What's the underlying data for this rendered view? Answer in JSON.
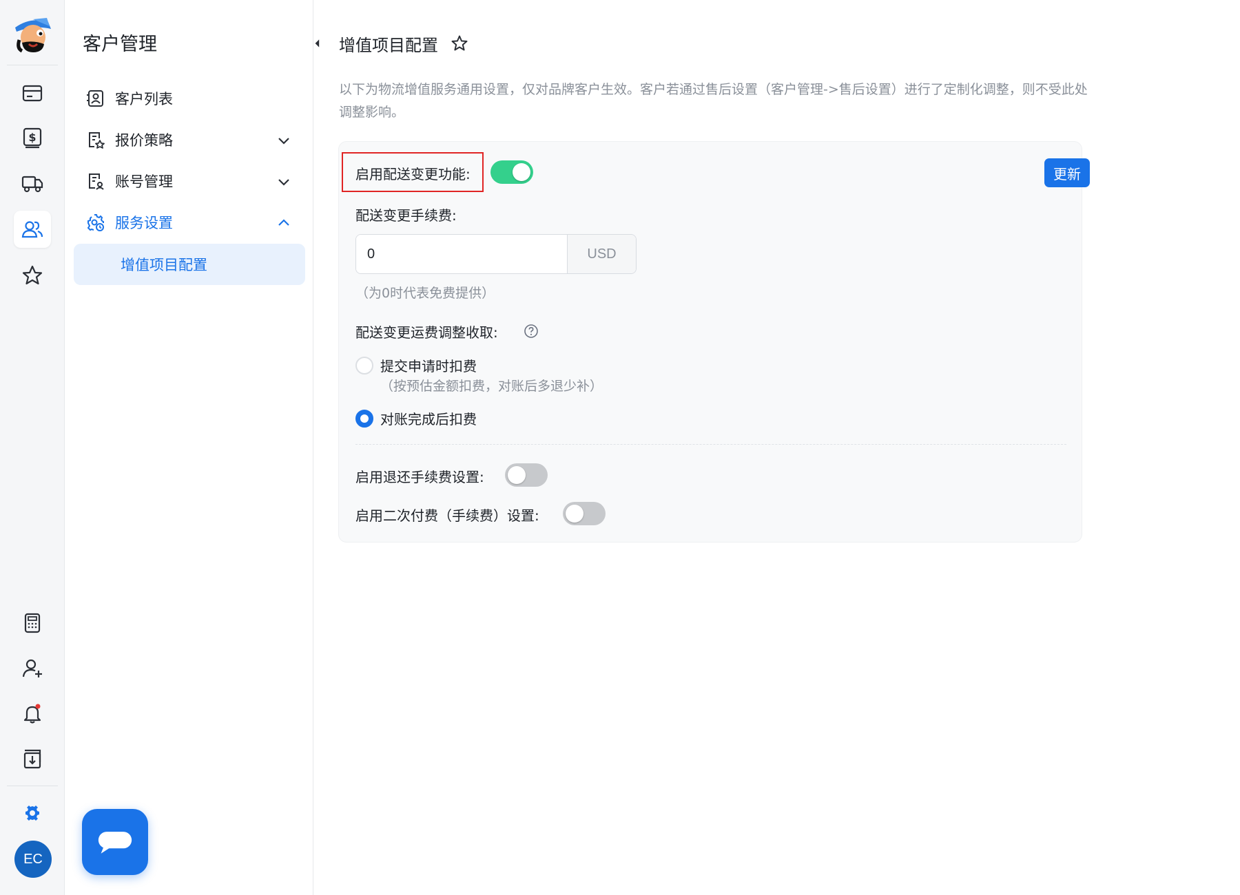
{
  "rail": {
    "items": [
      {
        "icon": "wallet-icon"
      },
      {
        "icon": "dollar-icon"
      },
      {
        "icon": "truck-icon"
      },
      {
        "icon": "users-icon",
        "active": true
      },
      {
        "icon": "star-icon"
      },
      {
        "icon": "calculator-icon"
      },
      {
        "icon": "add-user-icon"
      },
      {
        "icon": "bell-icon"
      },
      {
        "icon": "download-icon"
      },
      {
        "icon": "gear-icon"
      }
    ],
    "avatar_initials": "EC"
  },
  "sidebar": {
    "title": "客户管理",
    "items": [
      {
        "label": "客户列表",
        "icon": "customer-list-icon"
      },
      {
        "label": "报价策略",
        "icon": "pricing-icon",
        "chevron": "down"
      },
      {
        "label": "账号管理",
        "icon": "account-icon",
        "chevron": "down"
      },
      {
        "label": "服务设置",
        "icon": "service-settings-icon",
        "chevron": "up",
        "expanded": true
      }
    ],
    "sub_items": [
      {
        "label": "增值项目配置",
        "active": true
      }
    ]
  },
  "page": {
    "title": "增值项目配置",
    "description": "以下为物流增值服务通用设置，仅对品牌客户生效。客户若通过售后设置（客户管理->售后设置）进行了定制化调整，则不受此处调整影响。"
  },
  "form": {
    "delivery_change_label": "启用配送变更功能:",
    "delivery_change_enabled": true,
    "update_label": "更新",
    "fee_label": "配送变更手续费:",
    "fee_value": "0",
    "fee_unit": "USD",
    "fee_hint": "（为0时代表免费提供）",
    "adjust_label": "配送变更运费调整收取:",
    "options": [
      {
        "label": "提交申请时扣费",
        "hint": "（按预估金额扣费，对账后多退少补）",
        "checked": false
      },
      {
        "label": "对账完成后扣费",
        "checked": true
      }
    ],
    "refund_fee_label": "启用退还手续费设置:",
    "refund_fee_enabled": false,
    "second_pay_label": "启用二次付费（手续费）设置:",
    "second_pay_enabled": false
  },
  "colors": {
    "primary": "#1a73e8",
    "toggle_on": "#34d08c",
    "highlight_border": "#e02424"
  }
}
